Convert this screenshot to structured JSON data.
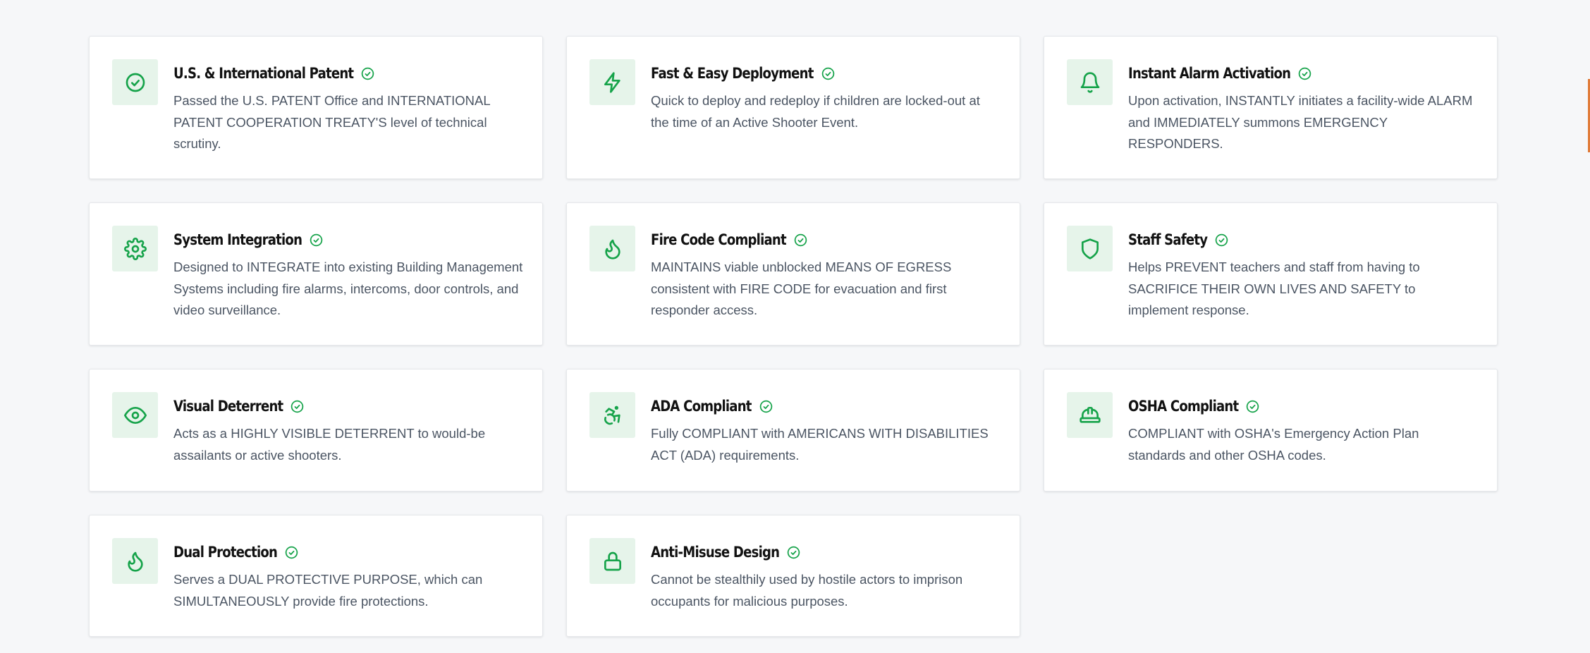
{
  "features": [
    {
      "icon": "check-circle-icon",
      "title": "U.S. & International Patent",
      "description": "Passed the U.S. PATENT Office and INTERNATIONAL PATENT COOPERATION TREATY'S level of technical scrutiny."
    },
    {
      "icon": "lightning-icon",
      "title": "Fast & Easy Deployment",
      "description": "Quick to deploy and redeploy if children are locked-out at the time of an Active Shooter Event."
    },
    {
      "icon": "bell-icon",
      "title": "Instant Alarm Activation",
      "description": "Upon activation, INSTANTLY initiates a facility-wide ALARM and IMMEDIATELY summons EMERGENCY RESPONDERS."
    },
    {
      "icon": "gear-icon",
      "title": "System Integration",
      "description": "Designed to INTEGRATE into existing Building Management Systems including fire alarms, intercoms, door controls, and video surveillance."
    },
    {
      "icon": "flame-icon",
      "title": "Fire Code Compliant",
      "description": "MAINTAINS viable unblocked MEANS OF EGRESS consistent with FIRE CODE for evacuation and first responder access."
    },
    {
      "icon": "shield-icon",
      "title": "Staff Safety",
      "description": "Helps PREVENT teachers and staff from having to SACRIFICE THEIR OWN LIVES AND SAFETY to implement response."
    },
    {
      "icon": "eye-icon",
      "title": "Visual Deterrent",
      "description": "Acts as a HIGHLY VISIBLE DETERRENT to would-be assailants or active shooters."
    },
    {
      "icon": "accessibility-icon",
      "title": "ADA Compliant",
      "description": "Fully COMPLIANT with AMERICANS WITH DISABILITIES ACT (ADA) requirements."
    },
    {
      "icon": "hard-hat-icon",
      "title": "OSHA Compliant",
      "description": "COMPLIANT with OSHA's Emergency Action Plan standards and other OSHA codes."
    },
    {
      "icon": "flame-icon",
      "title": "Dual Protection",
      "description": "Serves a DUAL PROTECTIVE PURPOSE, which can SIMULTANEOUSLY provide fire protections."
    },
    {
      "icon": "lock-icon",
      "title": "Anti-Misuse Design",
      "description": "Cannot be stealthily used by hostile actors to imprison occupants for malicious purposes."
    }
  ],
  "colors": {
    "accent": "#16a34a",
    "icon_bg": "#e6f4ea",
    "page_bg": "#f6f7f9",
    "title": "#111111",
    "text": "#4b5563"
  }
}
